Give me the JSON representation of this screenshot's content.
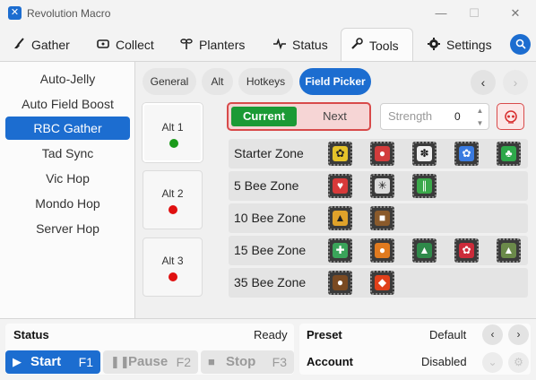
{
  "window": {
    "title": "Revolution Macro"
  },
  "tabs": [
    {
      "label": "Gather",
      "icon": "broom-icon"
    },
    {
      "label": "Collect",
      "icon": "ticket-icon"
    },
    {
      "label": "Planters",
      "icon": "plant-icon"
    },
    {
      "label": "Status",
      "icon": "pulse-icon"
    },
    {
      "label": "Tools",
      "icon": "wrench-icon"
    },
    {
      "label": "Settings",
      "icon": "gear-icon"
    }
  ],
  "active_tab": "Tools",
  "sidebar": {
    "items": [
      {
        "label": "Auto-Jelly"
      },
      {
        "label": "Auto Field Boost"
      },
      {
        "label": "RBC Gather"
      },
      {
        "label": "Tad Sync"
      },
      {
        "label": "Vic Hop"
      },
      {
        "label": "Mondo Hop"
      },
      {
        "label": "Server Hop"
      }
    ],
    "active": "RBC Gather"
  },
  "subtabs": [
    {
      "label": "General"
    },
    {
      "label": "Alt"
    },
    {
      "label": "Hotkeys"
    },
    {
      "label": "Field Picker"
    }
  ],
  "active_subtab": "Field Picker",
  "alts": [
    {
      "label": "Alt 1",
      "status": "green"
    },
    {
      "label": "Alt 2",
      "status": "red"
    },
    {
      "label": "Alt 3",
      "status": "red"
    }
  ],
  "toggle": {
    "current": "Current",
    "next": "Next",
    "selected": "Current"
  },
  "strength": {
    "placeholder": "Strength",
    "value": "0"
  },
  "zones": [
    {
      "label": "Starter Zone",
      "fields": [
        "sunflower-field",
        "mushroom-field",
        "dandelion-field",
        "blue-flower-field",
        "clover-field"
      ]
    },
    {
      "label": "5 Bee Zone",
      "fields": [
        "strawberry-field",
        "spider-field",
        "bamboo-field"
      ]
    },
    {
      "label": "10 Bee Zone",
      "fields": [
        "pineapple-field",
        "stump-field"
      ]
    },
    {
      "label": "15 Bee Zone",
      "fields": [
        "cactus-field",
        "pumpkin-field",
        "pine-tree-field",
        "rose-field",
        "mountain-top-field"
      ]
    },
    {
      "label": "35 Bee Zone",
      "fields": [
        "coconut-field",
        "pepper-field"
      ]
    }
  ],
  "bottom": {
    "status_label": "Status",
    "status_value": "Ready",
    "preset_label": "Preset",
    "preset_value": "Default",
    "account_label": "Account",
    "account_value": "Disabled",
    "start_label": "Start",
    "start_key": "F1",
    "pause_label": "Pause",
    "pause_key": "F2",
    "stop_label": "Stop",
    "stop_key": "F3"
  },
  "colors": {
    "accent": "#1c6dd0",
    "current_green": "#1b9a35",
    "alert_red": "#d84a4a",
    "status_green": "#1a9a1a",
    "status_red": "#e01010"
  }
}
